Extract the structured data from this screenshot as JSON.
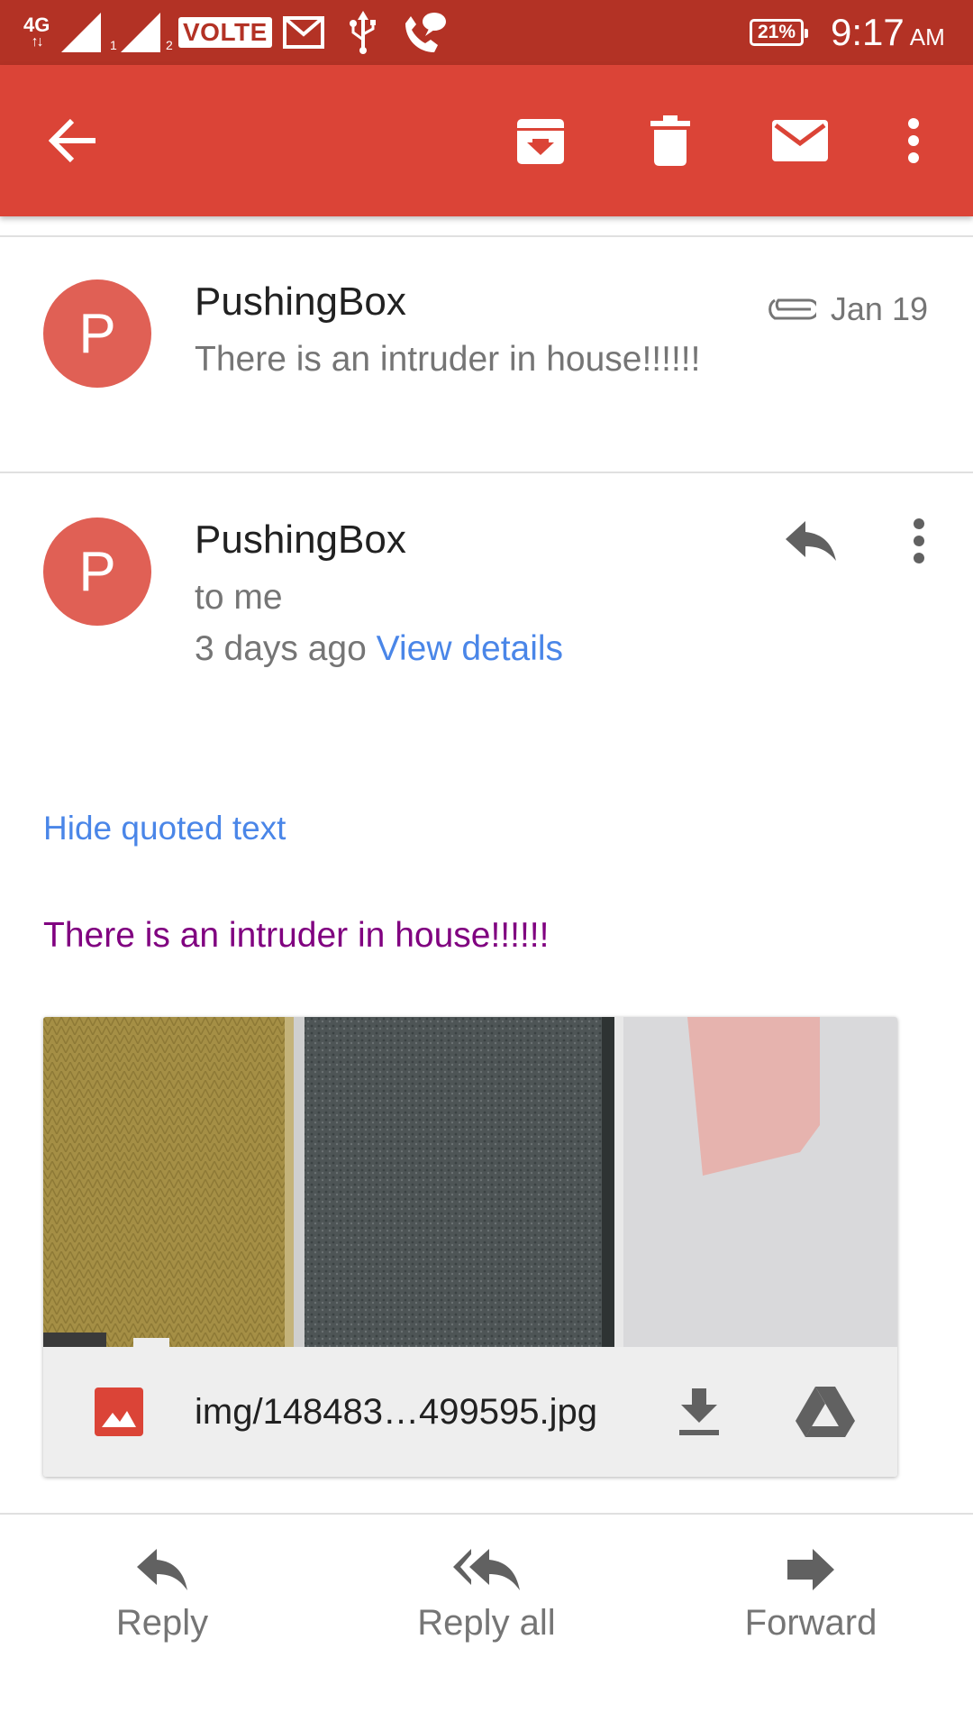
{
  "status_bar": {
    "network": "4G",
    "sim1": "1",
    "sim2": "2",
    "volte": "VOLTE",
    "battery": "21%",
    "time": "9:17",
    "ampm": "AM"
  },
  "app_bar": {
    "icons": [
      "back-arrow-icon",
      "archive-icon",
      "delete-icon",
      "mark-unread-icon",
      "more-vert-icon"
    ]
  },
  "collapsed_message": {
    "avatar_letter": "P",
    "sender": "PushingBox",
    "snippet": "There is an intruder in house!!!!!!",
    "date": "Jan 19",
    "has_attachment": true
  },
  "expanded_message": {
    "avatar_letter": "P",
    "sender": "PushingBox",
    "recipient": "to me",
    "time_ago": "3 days ago",
    "view_details": "View details",
    "hide_quoted": "Hide quoted text",
    "body": "There is an intruder in house!!!!!!"
  },
  "attachment": {
    "filename": "img/148483…499595.jpg",
    "type_icon": "image-file-icon",
    "actions": [
      "download-icon",
      "drive-icon"
    ]
  },
  "colors": {
    "status_bar": "#B33225",
    "app_bar": "#DB4437",
    "avatar": "#E06055",
    "link": "#4A86E8",
    "body_text": "#800080"
  },
  "bottom_actions": {
    "reply": "Reply",
    "reply_all": "Reply all",
    "forward": "Forward"
  }
}
